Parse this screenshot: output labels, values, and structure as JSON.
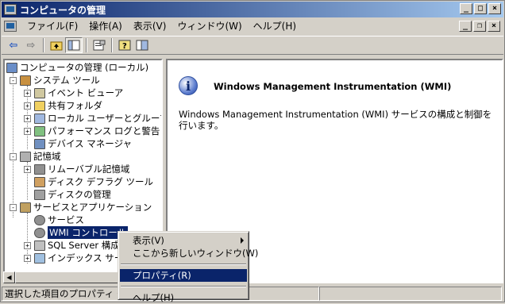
{
  "window": {
    "title": "コンピュータの管理"
  },
  "caption_buttons": {
    "minimize": "_",
    "maximize": "□",
    "close": "×"
  },
  "mdi_buttons": {
    "minimize": "_",
    "restore": "❐",
    "close": "×"
  },
  "menubar": {
    "items": [
      "ファイル(F)",
      "操作(A)",
      "表示(V)",
      "ウィンドウ(W)",
      "ヘルプ(H)"
    ]
  },
  "toolbar": {
    "icons": [
      "back-arrow-icon",
      "forward-arrow-icon",
      "up-folder-icon",
      "show-tree-icon",
      "properties-icon",
      "help-icon",
      "console-icon"
    ],
    "back_glyph": "⇦",
    "forward_glyph": "⇨"
  },
  "tree": {
    "root": "コンピュータの管理 (ローカル)",
    "system_tools": "システム ツール",
    "event_viewer": "イベント ビューア",
    "shared_folders": "共有フォルダ",
    "local_users": "ローカル ユーザーとグループ",
    "performance": "パフォーマンス ログと警告",
    "device_manager": "デバイス マネージャ",
    "storage": "記憶域",
    "removable_storage": "リムーバブル記憶域",
    "disk_defrag": "ディスク デフラグ ツール",
    "disk_management": "ディスクの管理",
    "services_apps": "サービスとアプリケーション",
    "services": "サービス",
    "wmi_control": "WMI コントロール",
    "sql_server": "SQL Server 構成",
    "indexing": "インデックス サービ"
  },
  "right_pane": {
    "title": "Windows Management Instrumentation (WMI)",
    "description": "Windows Management Instrumentation (WMI) サービスの構成と制御を行います。"
  },
  "context_menu": {
    "view": "表示(V)",
    "new_window": "ここから新しいウィンドウ(W)",
    "properties": "プロパティ(R)",
    "help": "ヘルプ(H)"
  },
  "statusbar": {
    "text": "選択した項目のプロパティ ダイ"
  }
}
